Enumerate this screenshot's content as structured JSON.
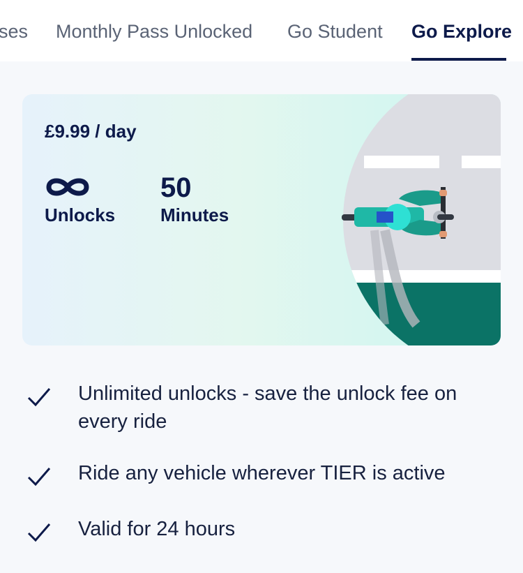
{
  "tabs": [
    {
      "label": "ses"
    },
    {
      "label": "Monthly Pass Unlocked"
    },
    {
      "label": "Go Student"
    },
    {
      "label": "Go Explore",
      "active": true
    }
  ],
  "card": {
    "price": "£9.99 / day",
    "stats": [
      {
        "icon": "infinity-icon",
        "label": "Unlocks"
      },
      {
        "value": "50",
        "label": "Minutes"
      }
    ]
  },
  "features": [
    {
      "icon": "check-icon",
      "text": "Unlimited unlocks - save the unlock fee on every ride"
    },
    {
      "icon": "check-icon",
      "text": "Ride any vehicle wherever TIER is active"
    },
    {
      "icon": "check-icon",
      "text": "Valid for 24 hours"
    }
  ],
  "colors": {
    "navy": "#0d1a4a",
    "tab_inactive": "#5a6375",
    "road_green": "#0b7366",
    "scooter_teal": "#1fb8a6"
  }
}
